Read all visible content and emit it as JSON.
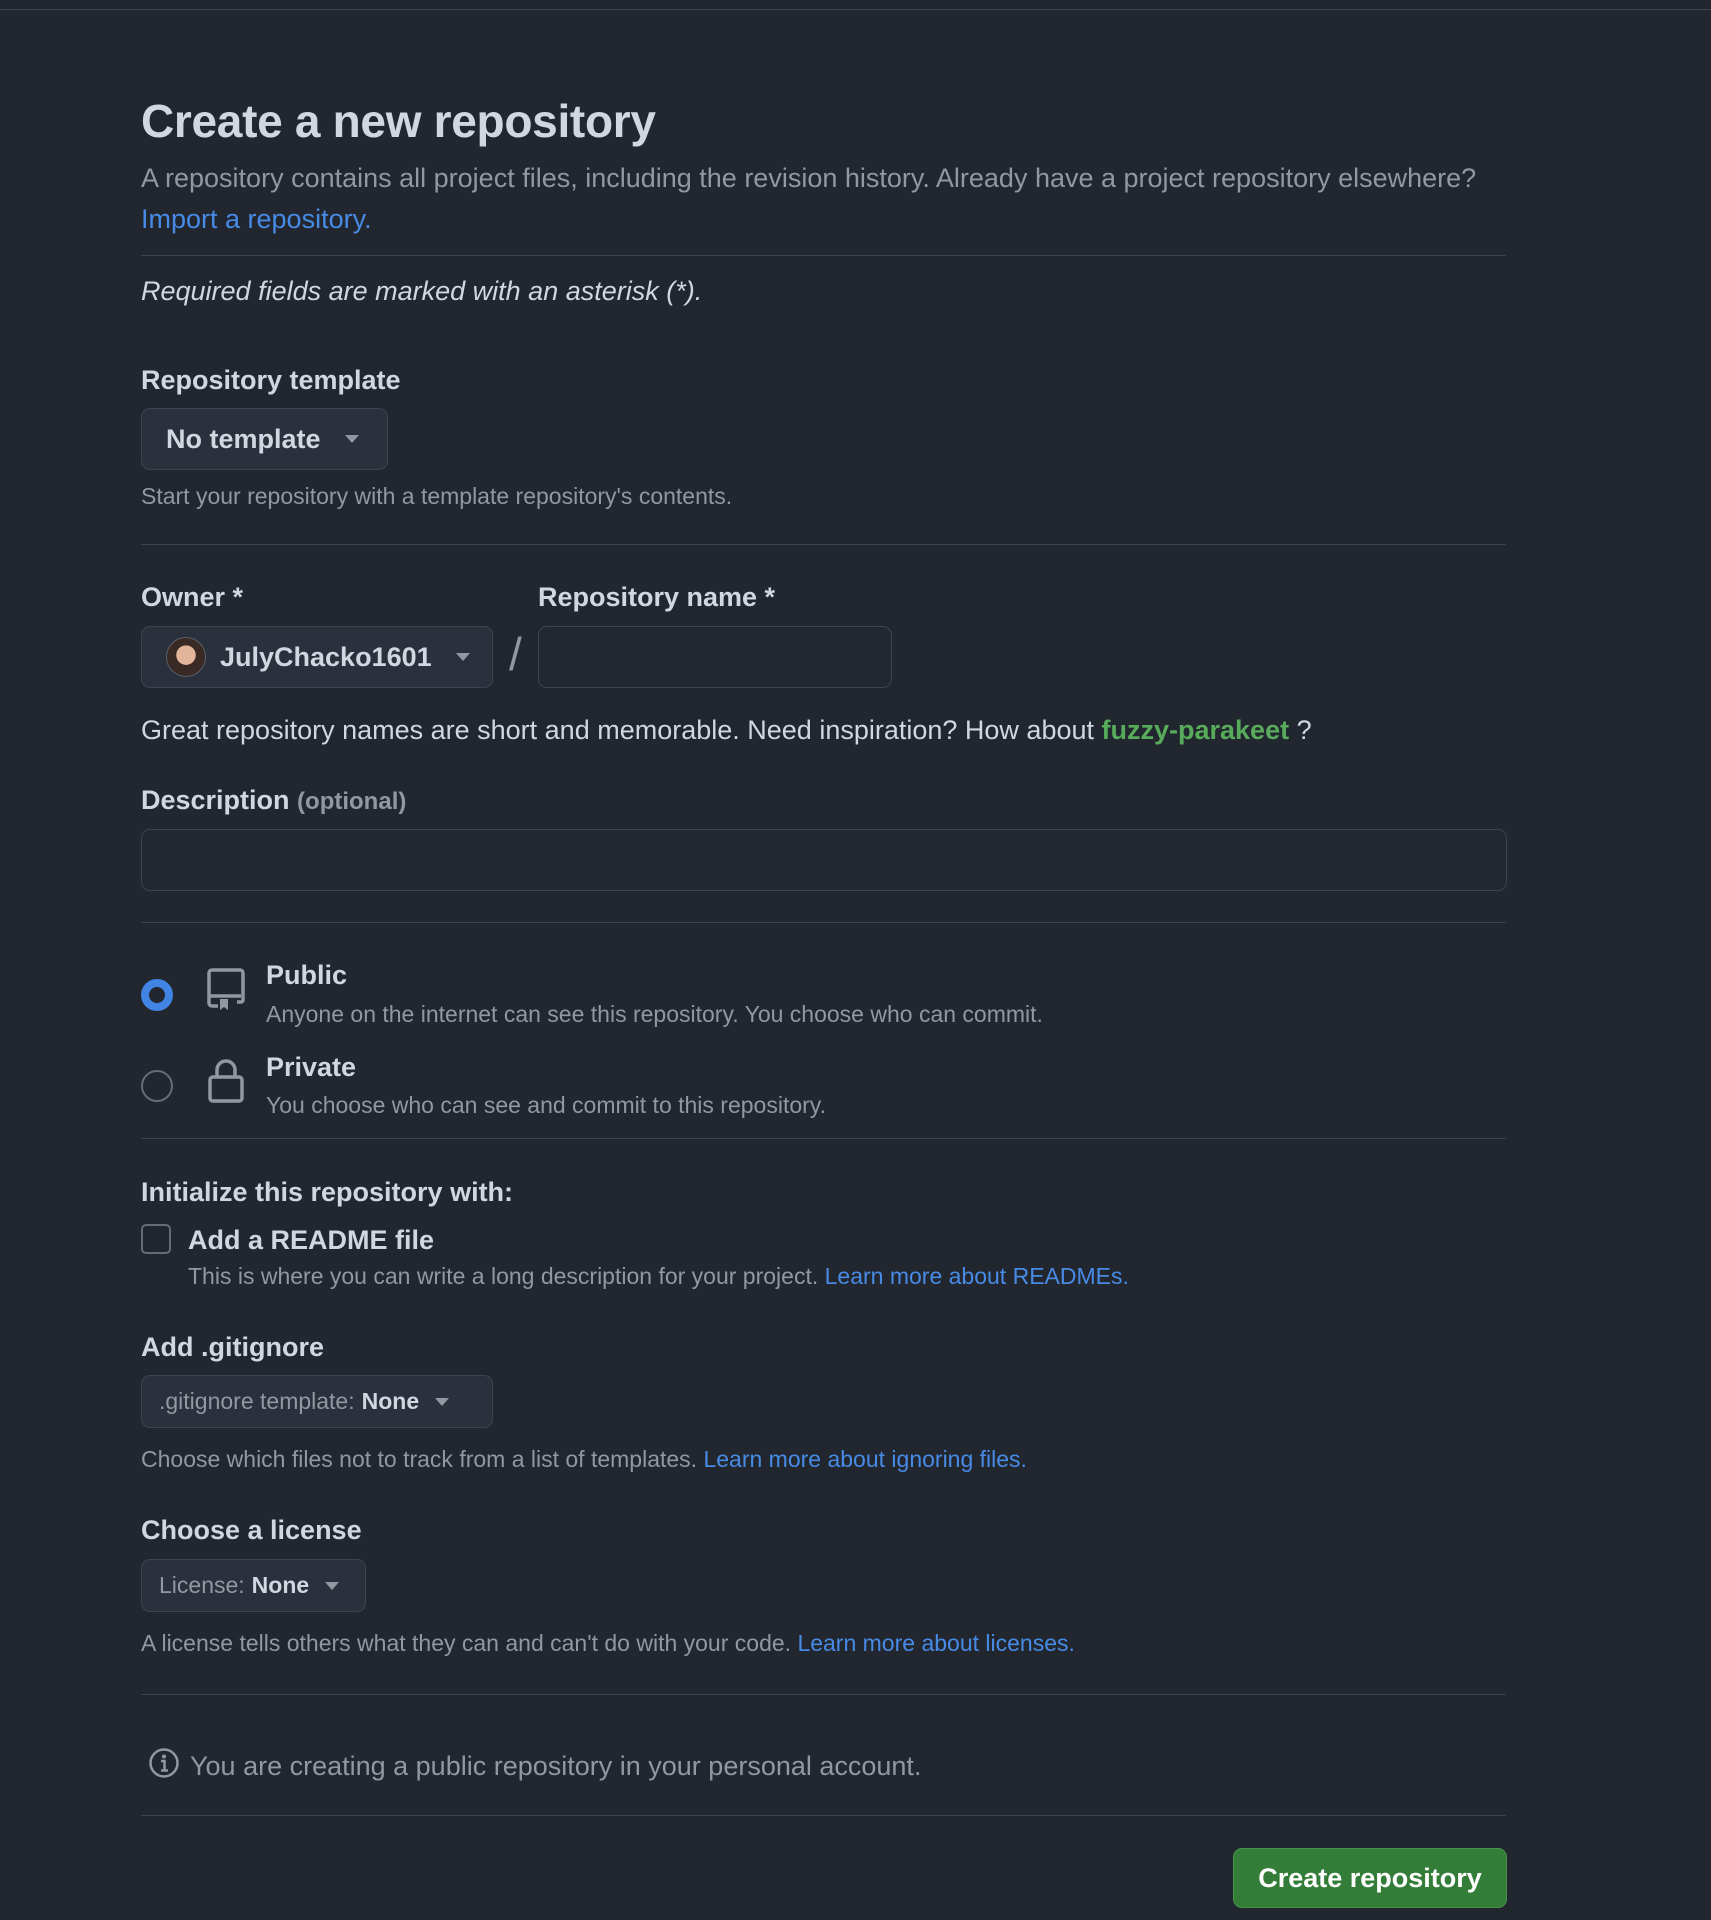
{
  "page": {
    "title": "Create a new repository",
    "intro_text": "A repository contains all project files, including the revision history. Already have a project repository elsewhere?",
    "import_link": "Import a repository.",
    "required_note": "Required fields are marked with an asterisk (*)."
  },
  "template": {
    "label": "Repository template",
    "button_label": "No template",
    "hint": "Start your repository with a template repository's contents."
  },
  "owner": {
    "label": "Owner *",
    "value": "JulyChacko1601"
  },
  "separator": "/",
  "repo_name": {
    "label": "Repository name *",
    "value": ""
  },
  "suggestion": {
    "prefix": "Great repository names are short and memorable. Need inspiration? How about",
    "name": "fuzzy-parakeet",
    "suffix": " ?"
  },
  "description": {
    "label": "Description",
    "optional": "(optional)",
    "value": ""
  },
  "visibility": {
    "selected": "public",
    "options": [
      {
        "title": "Public",
        "desc": "Anyone on the internet can see this repository. You choose who can commit.",
        "icon": "repo-icon"
      },
      {
        "title": "Private",
        "desc": "You choose who can see and commit to this repository.",
        "icon": "lock-icon"
      }
    ]
  },
  "initialize": {
    "heading": "Initialize this repository with:",
    "readme": {
      "label": "Add a README file",
      "checked": false,
      "desc": "This is where you can write a long description for your project.",
      "link": "Learn more about READMEs."
    }
  },
  "gitignore": {
    "label": "Add .gitignore",
    "button_prefix": ".gitignore template:",
    "button_value": "None",
    "hint": "Choose which files not to track from a list of templates.",
    "link": "Learn more about ignoring files."
  },
  "license": {
    "label": "Choose a license",
    "button_prefix": "License:",
    "button_value": "None",
    "hint": "A license tells others what they can and can't do with your code.",
    "link": "Learn more about licenses."
  },
  "info": {
    "text": "You are creating a public repository in your personal account."
  },
  "submit": {
    "label": "Create repository"
  },
  "colors": {
    "background": "#22262e",
    "link": "#478be6",
    "suggestion": "#57ab5a",
    "primary_button": "#347d39",
    "radio_selected": "#4184e4"
  }
}
